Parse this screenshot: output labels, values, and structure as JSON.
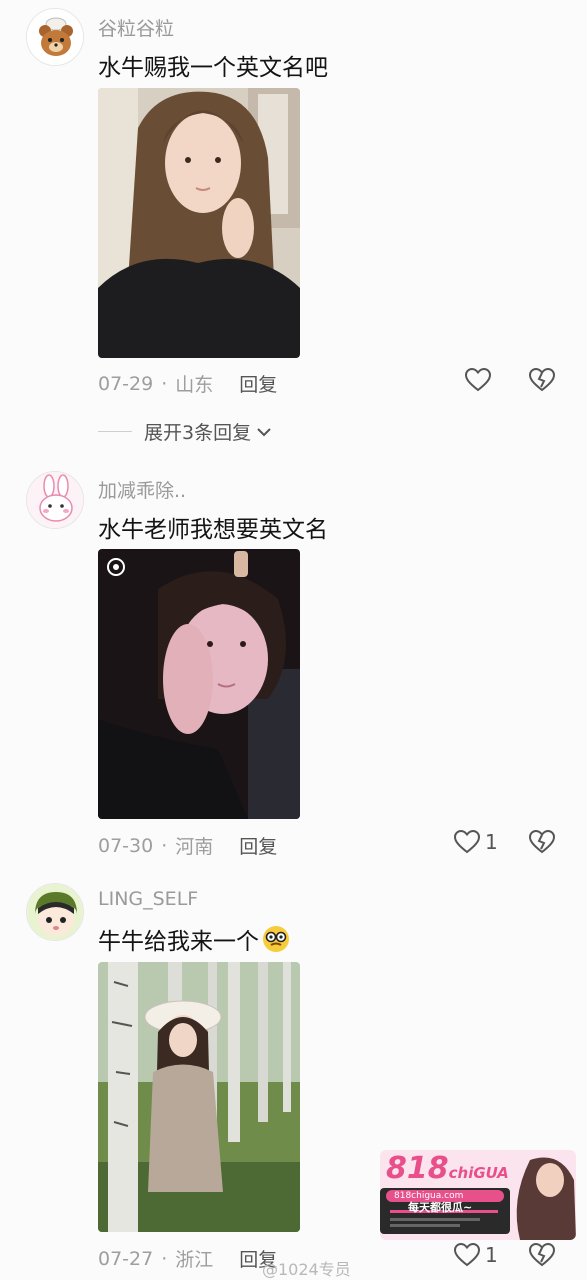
{
  "comments": [
    {
      "username": "谷粒谷粒",
      "text": "水牛赐我一个英文名吧",
      "date": "07-29",
      "location": "山东",
      "reply_label": "回复",
      "likes": "",
      "expand_label": "展开3条回复"
    },
    {
      "username": "加减乖除..",
      "text": "水牛老师我想要英文名",
      "date": "07-30",
      "location": "河南",
      "reply_label": "回复",
      "likes": "1"
    },
    {
      "username": "LING_SELF",
      "text": "牛牛给我来一个",
      "date": "07-27",
      "location": "浙江",
      "reply_label": "回复",
      "likes": "1"
    }
  ],
  "meta_separator": "·",
  "watermark": "@1024专员",
  "ad": {
    "logo": "818",
    "logo_suffix": "chiGUA",
    "domain": "818chigua.com",
    "slogan": "每天都很瓜~"
  },
  "colors": {
    "accent_pink": "#e8508c",
    "text_gray": "#9a9a9a"
  }
}
